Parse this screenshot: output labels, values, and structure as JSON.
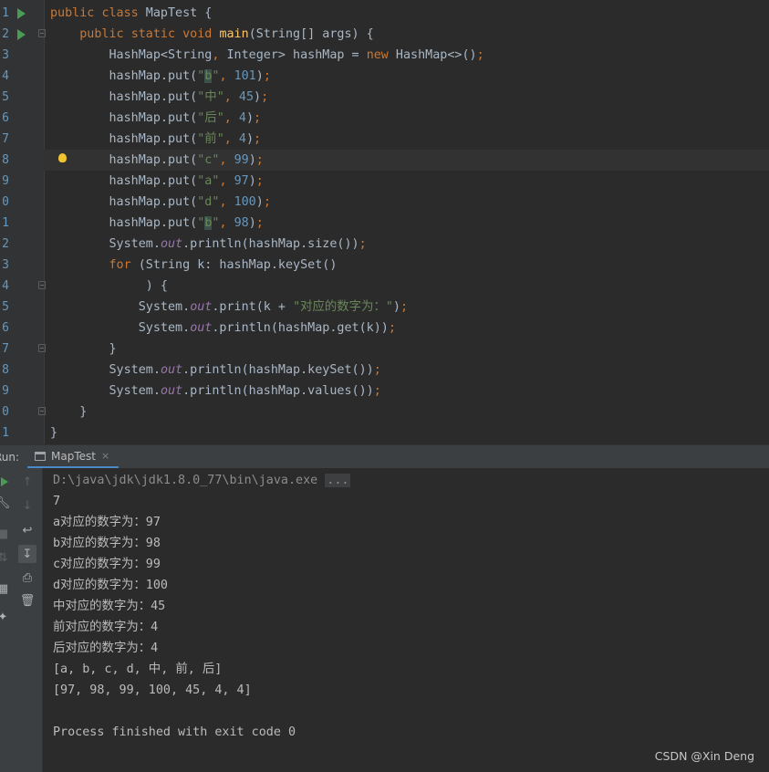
{
  "editor": {
    "gutter_numbers": [
      "1",
      "2",
      "3",
      "4",
      "5",
      "6",
      "7",
      "8",
      "9",
      "0",
      "1",
      "2",
      "3",
      "4",
      "5",
      "6",
      "7",
      "8",
      "9",
      "0",
      "1"
    ],
    "lines": [
      "public class MapTest {",
      "    public static void main(String[] args) {",
      "        HashMap<String, Integer> hashMap = new HashMap<>();",
      "        hashMap.put(\"b\", 101);",
      "        hashMap.put(\"中\", 45);",
      "        hashMap.put(\"后\", 4);",
      "        hashMap.put(\"前\", 4);",
      "        hashMap.put(\"c\", 99);",
      "        hashMap.put(\"a\", 97);",
      "        hashMap.put(\"d\", 100);",
      "        hashMap.put(\"b\", 98);",
      "        System.out.println(hashMap.size());",
      "        for (String k: hashMap.keySet()",
      "             ) {",
      "            System.out.print(k + \"对应的数字为：\");",
      "            System.out.println(hashMap.get(k));",
      "        }",
      "        System.out.println(hashMap.keySet());",
      "        System.out.println(hashMap.values());",
      "    }",
      "}"
    ]
  },
  "run_panel": {
    "label": "Run:",
    "tab_title": "MapTest",
    "tab_close": "×"
  },
  "console": {
    "command": "D:\\java\\jdk\\jdk1.8.0_77\\bin\\java.exe",
    "command_ellipsis": "...",
    "output": [
      "7",
      "a对应的数字为：97",
      "b对应的数字为：98",
      "c对应的数字为：99",
      "d对应的数字为：100",
      "中对应的数字为：45",
      "前对应的数字为：4",
      "后对应的数字为：4",
      "[a, b, c, d, 中, 前, 后]",
      "[97, 98, 99, 100, 45, 4, 4]",
      "",
      "Process finished with exit code 0"
    ]
  },
  "watermark": "CSDN @Xin Deng",
  "colors": {
    "keyword": "#cc7832",
    "string": "#6a8759",
    "number": "#6897bb",
    "method": "#ffc66d",
    "field": "#9876aa",
    "text": "#a9b7c6",
    "run_green": "#499c54"
  }
}
